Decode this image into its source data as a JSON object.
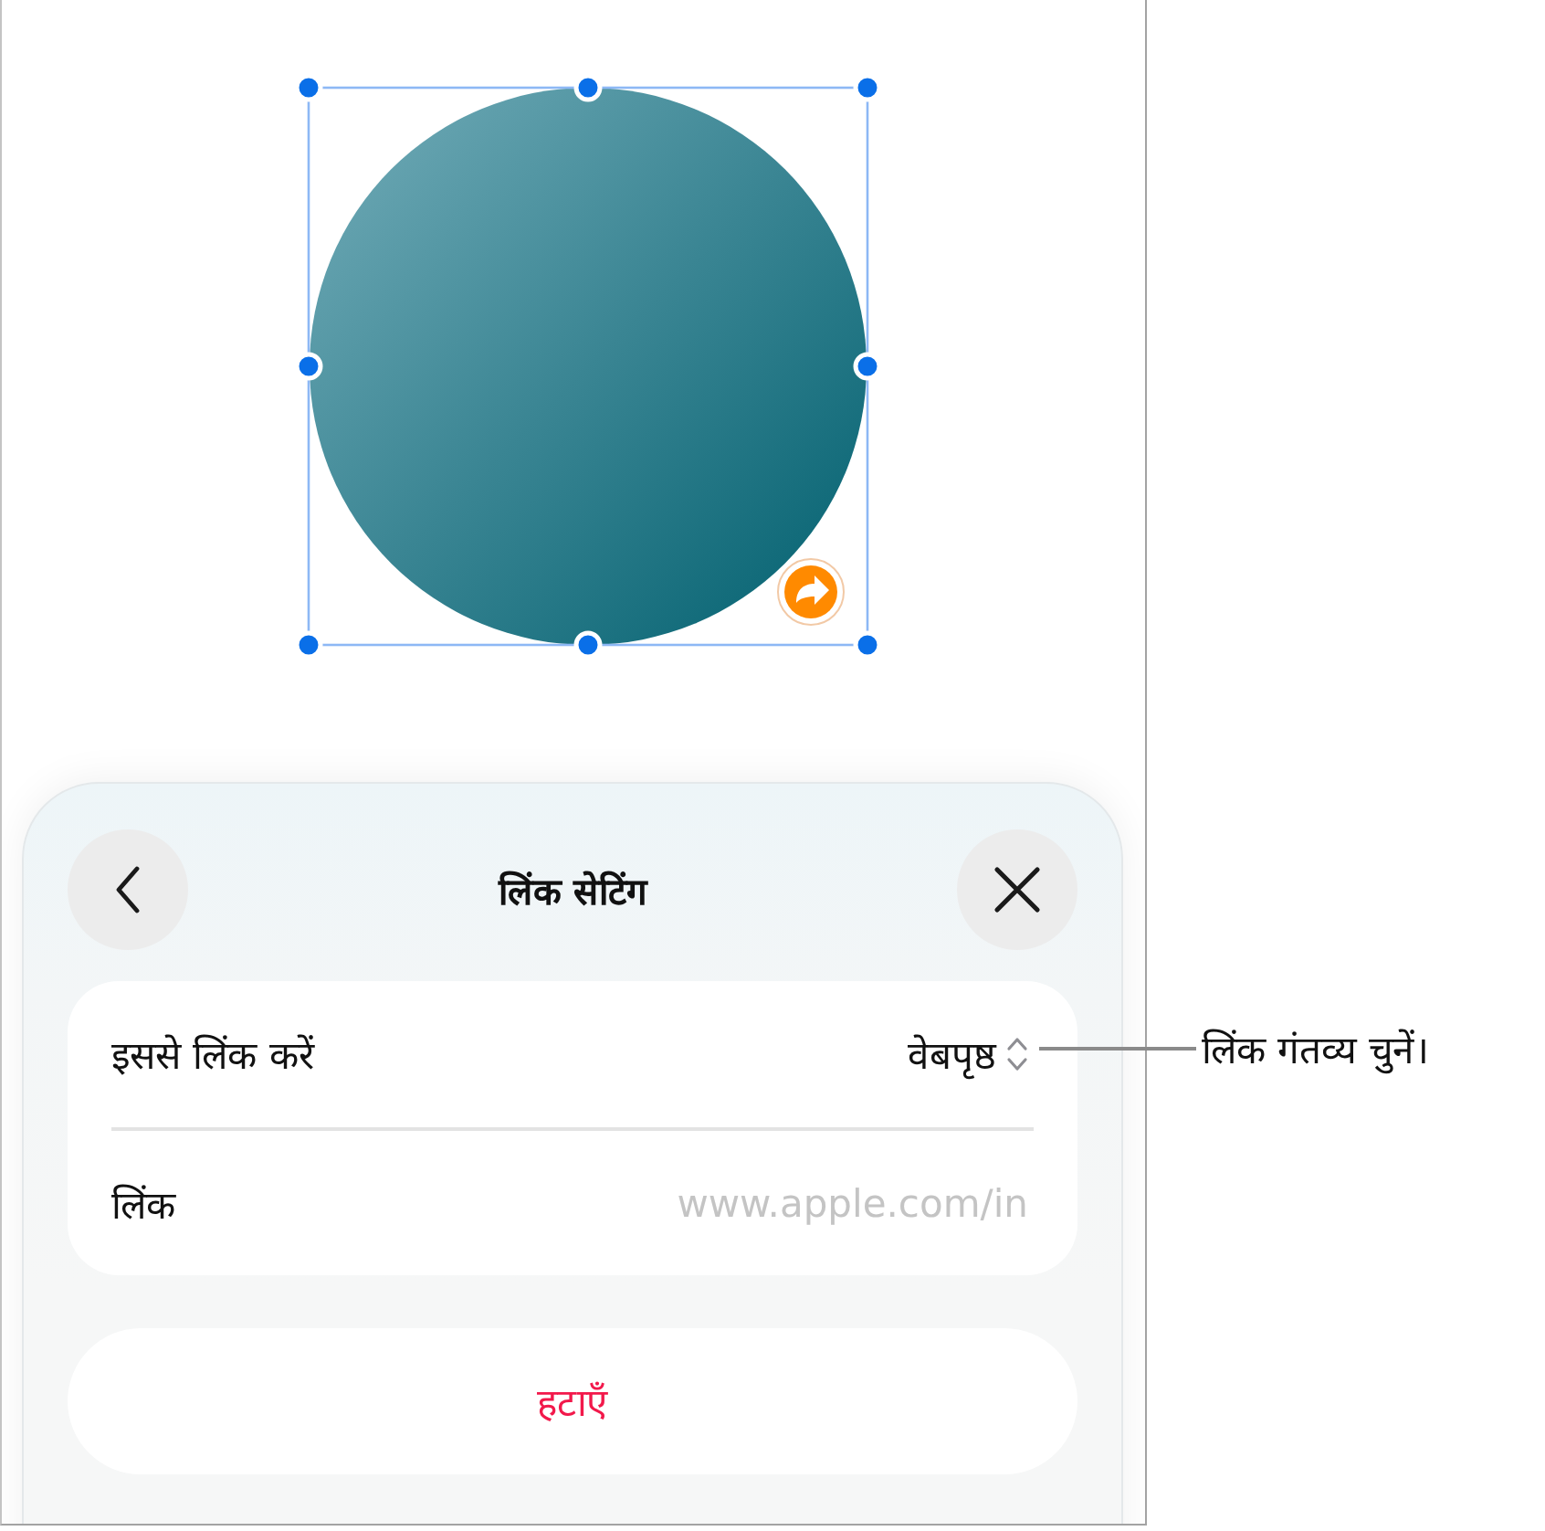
{
  "canvas": {
    "shape": {
      "kind": "circle",
      "selected": true,
      "has_link": true
    }
  },
  "sheet": {
    "title": "लिंक सेटिंग",
    "rows": [
      {
        "kind": "popup",
        "label": "इससे लिंक करें",
        "value": "वेबपृष्ठ"
      },
      {
        "kind": "field",
        "label": "लिंक",
        "placeholder": "www.apple.com/in"
      }
    ],
    "remove_button": "हटाएँ"
  },
  "callout": {
    "text": "लिंक गंतव्य चुनें।"
  }
}
